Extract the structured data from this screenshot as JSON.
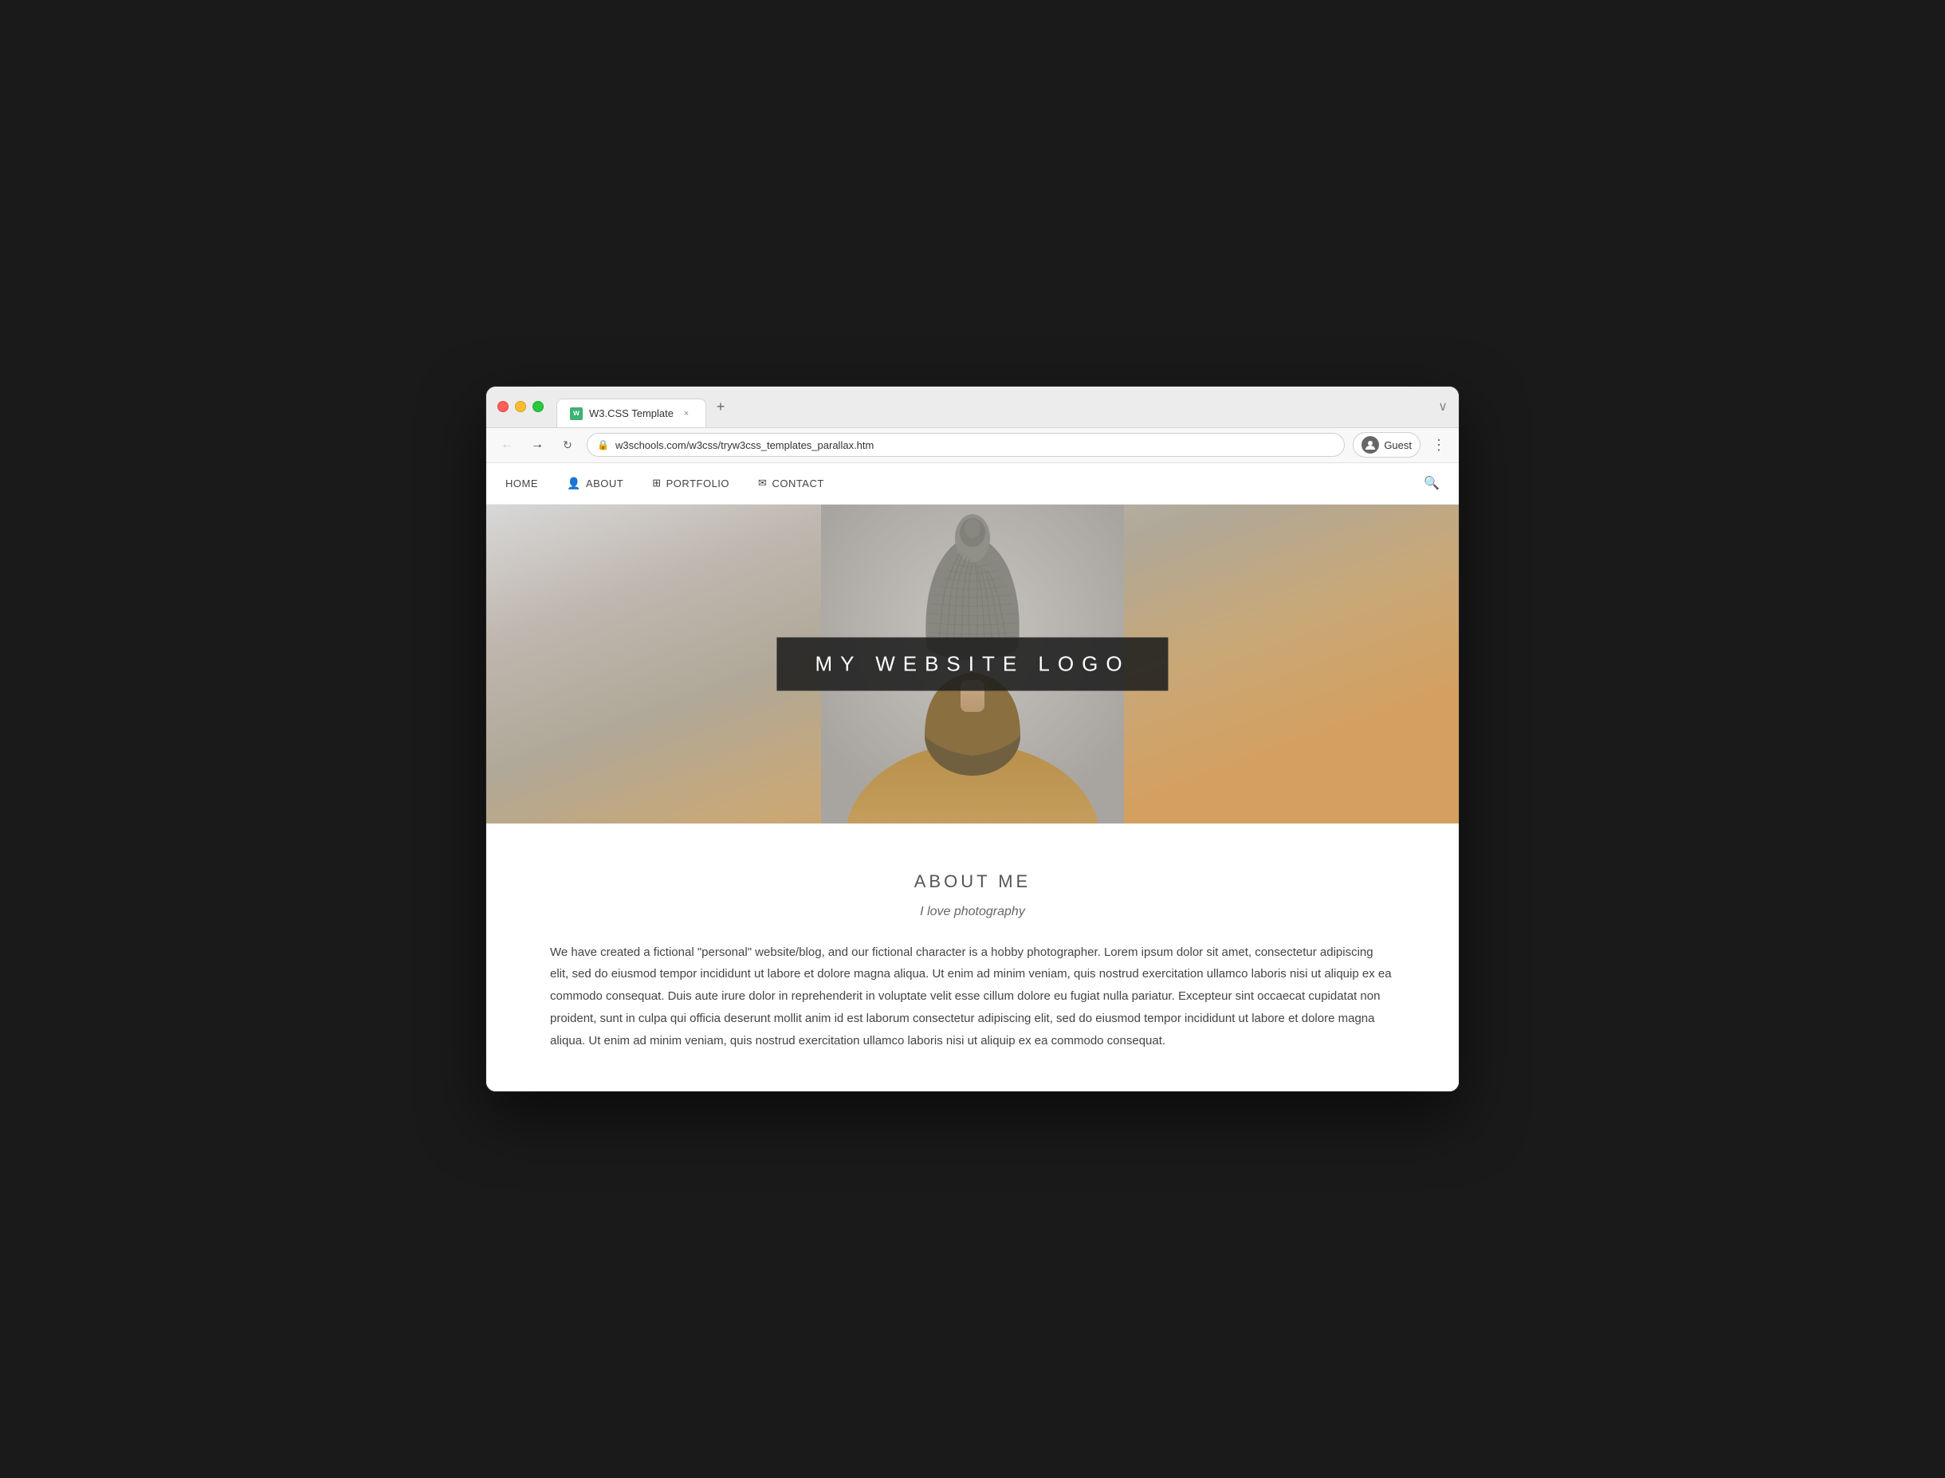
{
  "window": {
    "title": "W3.CSS Template",
    "favicon_letter": "w",
    "tab_close": "×",
    "tab_new": "+",
    "controls_expand": "∨"
  },
  "address_bar": {
    "url": "w3schools.com/w3css/tryw3css_templates_parallax.htm",
    "profile_label": "Guest",
    "back_icon": "←",
    "forward_icon": "→",
    "reload_icon": "↻"
  },
  "site": {
    "nav": {
      "items": [
        {
          "label": "HOME",
          "icon": ""
        },
        {
          "label": "ABOUT",
          "icon": "person"
        },
        {
          "label": "PORTFOLIO",
          "icon": "grid"
        },
        {
          "label": "CONTACT",
          "icon": "envelope"
        }
      ],
      "search_icon": "🔍"
    },
    "hero": {
      "logo_text": "MY WEBSITE LOGO"
    },
    "about": {
      "title": "ABOUT ME",
      "subtitle": "I love photography",
      "body": "We have created a fictional \"personal\" website/blog, and our fictional character is a hobby photographer. Lorem ipsum dolor sit amet, consectetur adipiscing elit, sed do eiusmod tempor incididunt ut labore et dolore magna aliqua. Ut enim ad minim veniam, quis nostrud exercitation ullamco laboris nisi ut aliquip ex ea commodo consequat. Duis aute irure dolor in reprehenderit in voluptate velit esse cillum dolore eu fugiat nulla pariatur. Excepteur sint occaecat cupidatat non proident, sunt in culpa qui officia deserunt mollit anim id est laborum consectetur adipiscing elit, sed do eiusmod tempor incididunt ut labore et dolore magna aliqua. Ut enim ad minim veniam, quis nostrud exercitation ullamco laboris nisi ut aliquip ex ea commodo consequat."
    }
  }
}
